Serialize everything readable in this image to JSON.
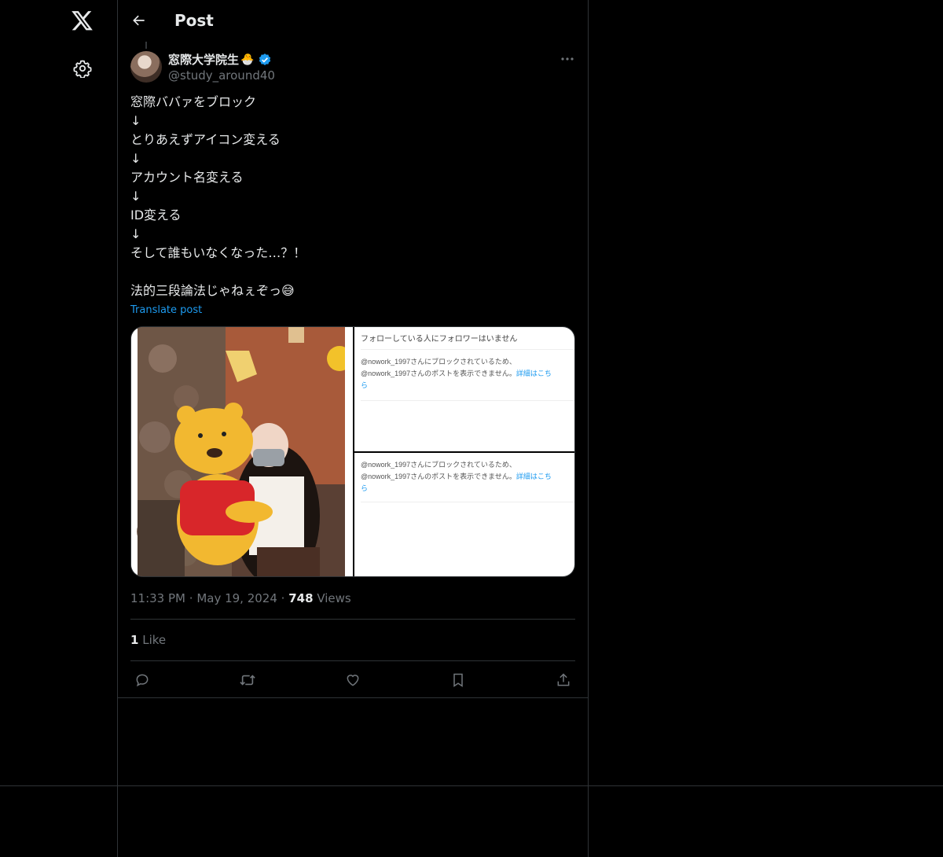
{
  "header": {
    "title": "Post"
  },
  "post": {
    "display_name": "窓際大学院生",
    "name_emoji": "🐣",
    "handle": "@study_around40",
    "lines": [
      "窓際ババァをブロック",
      "↓",
      "とりあえずアイコン変える",
      "↓",
      "アカウント名変える",
      "↓",
      "ID変える",
      "↓",
      "そして誰もいなくなった…？！",
      "",
      "法的三段論法じゃねぇぞっ"
    ],
    "trailing_emoji": "😅",
    "translate_label": "Translate post",
    "time": "11:33 PM",
    "date": "May 19, 2024",
    "views_count": "748",
    "views_label": "Views",
    "likes_count": "1",
    "likes_label": "Like"
  },
  "media": {
    "top_right": {
      "heading": "フォローしている人にフォロワーはいません",
      "line1": "@nowork_1997さんにブロックされているため、",
      "line2": "@nowork_1997さんのポストを表示できません。",
      "link": "詳細はこち",
      "link_tail": "ら"
    },
    "bottom_right": {
      "line1": "@nowork_1997さんにブロックされているため、",
      "line2": "@nowork_1997さんのポストを表示できません。",
      "link": "詳細はこち",
      "link_tail": "ら"
    }
  },
  "icons": {
    "logo": "x-logo-icon",
    "settings": "gear-icon",
    "back": "arrow-left-icon",
    "verified": "verified-badge-icon",
    "more": "more-horizontal-icon",
    "reply": "reply-icon",
    "repost": "repost-icon",
    "like": "heart-icon",
    "bookmark": "bookmark-icon",
    "share": "share-icon"
  },
  "colors": {
    "accent": "#1d9bf0",
    "background": "#000000",
    "border": "#2f3336",
    "muted": "#71767b"
  }
}
